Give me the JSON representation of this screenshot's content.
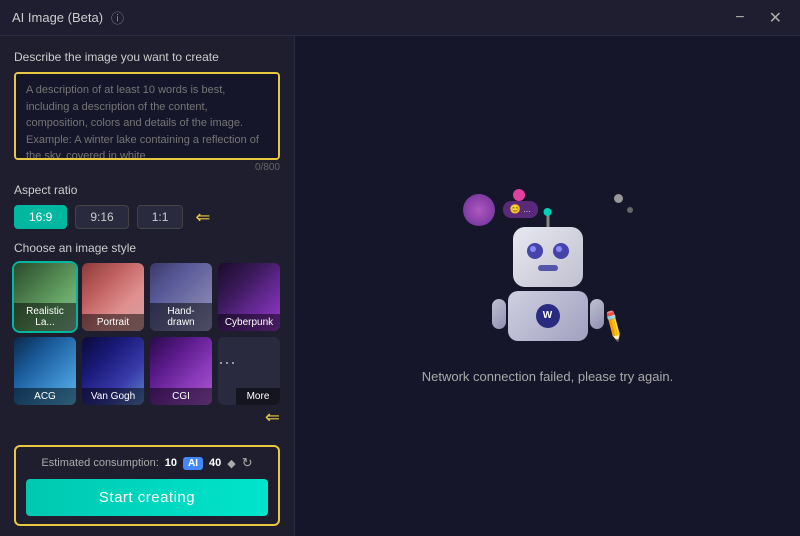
{
  "titlebar": {
    "title": "AI Image (Beta)",
    "info_icon": "ⓘ",
    "minimize_label": "−",
    "close_label": "✕"
  },
  "left_panel": {
    "description_label": "Describe the image you want to create",
    "description_placeholder": "A description of at least 10 words is best, including a description of the content, composition, colors and details of the image. Example: A winter lake containing a reflection of the sky, covered in white",
    "char_count": "0/800",
    "aspect_ratio_label": "Aspect ratio",
    "aspect_options": [
      {
        "id": "16-9",
        "label": "16:9",
        "active": true
      },
      {
        "id": "9-16",
        "label": "9:16",
        "active": false
      },
      {
        "id": "1-1",
        "label": "1:1",
        "active": false
      }
    ],
    "style_label": "Choose an image style",
    "styles": [
      {
        "id": "realistic",
        "label": "Realistic La...",
        "selected": true,
        "bg_class": "style-realistic"
      },
      {
        "id": "portrait",
        "label": "Portrait",
        "selected": false,
        "bg_class": "style-portrait"
      },
      {
        "id": "handdrawn",
        "label": "Hand-drawn",
        "selected": false,
        "bg_class": "style-handdrawn"
      },
      {
        "id": "cyberpunk",
        "label": "Cyberpunk",
        "selected": false,
        "bg_class": "style-cyberpunk"
      },
      {
        "id": "acg",
        "label": "ACG",
        "selected": false,
        "bg_class": "style-acg"
      },
      {
        "id": "vangogh",
        "label": "Van Gogh",
        "selected": false,
        "bg_class": "style-vangogh"
      },
      {
        "id": "cgi",
        "label": "CGI",
        "selected": false,
        "bg_class": "style-cgi"
      },
      {
        "id": "more",
        "label": "More",
        "selected": false,
        "bg_class": "style-more"
      }
    ],
    "consumption_label": "Estimated consumption:",
    "consumption_value": "10",
    "ai_badge": "AI",
    "credits": "40",
    "start_button_label": "Start creating"
  },
  "right_panel": {
    "error_message": "Network connection failed, please try again.",
    "robot_logo": "W"
  }
}
